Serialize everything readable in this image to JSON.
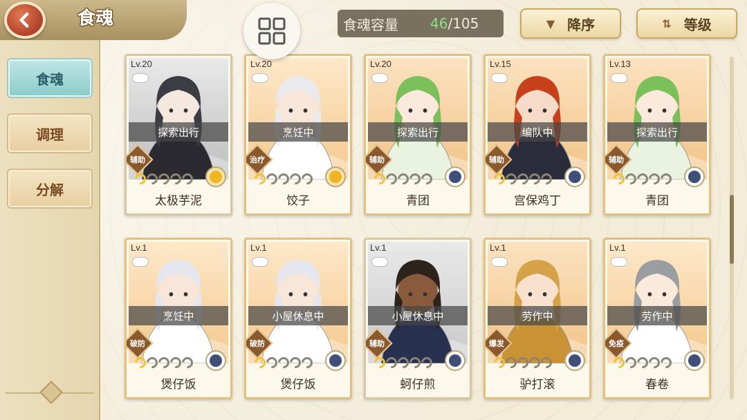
{
  "header": {
    "back_icon": "chevron-left-icon",
    "title": "食魂",
    "grid_icon": "grid-view-icon",
    "capacity_label": "食魂容量",
    "capacity_current": "46",
    "capacity_total": "/105",
    "sort_order_label": "降序",
    "sort_field_label": "等级"
  },
  "sidebar": {
    "tabs": [
      {
        "label": "食魂",
        "active": true
      },
      {
        "label": "调理",
        "active": false
      },
      {
        "label": "分解",
        "active": false
      }
    ]
  },
  "cards": [
    {
      "level": "Lv.20",
      "status": "探索出行",
      "role": "辅助",
      "stars": 1,
      "name": "太极芋泥",
      "element": "yellow",
      "palette": "mono"
    },
    {
      "level": "Lv.20",
      "status": "烹饪中",
      "role": "治疗",
      "stars": 1,
      "name": "饺子",
      "element": "yellow",
      "palette": "white"
    },
    {
      "level": "Lv.20",
      "status": "探索出行",
      "role": "辅助",
      "stars": 1,
      "name": "青团",
      "element": "blue",
      "palette": "green"
    },
    {
      "level": "Lv.15",
      "status": "编队中",
      "role": "辅助",
      "stars": 1,
      "name": "宫保鸡丁",
      "element": "blue",
      "palette": "red"
    },
    {
      "level": "Lv.13",
      "status": "探索出行",
      "role": "辅助",
      "stars": 1,
      "name": "青团",
      "element": "blue",
      "palette": "green"
    },
    {
      "level": "Lv.1",
      "status": "烹饪中",
      "role": "破防",
      "stars": 1,
      "name": "煲仔饭",
      "element": "blue",
      "palette": "teal"
    },
    {
      "level": "Lv.1",
      "status": "小屋休息中",
      "role": "破防",
      "stars": 1,
      "name": "煲仔饭",
      "element": "blue",
      "palette": "teal"
    },
    {
      "level": "Lv.1",
      "status": "小屋休息中",
      "role": "辅助",
      "stars": 1,
      "name": "蚵仔煎",
      "element": "blue",
      "palette": "dark"
    },
    {
      "level": "Lv.1",
      "status": "劳作中",
      "role": "爆发",
      "stars": 1,
      "name": "驴打滚",
      "element": "blue",
      "palette": "gold"
    },
    {
      "level": "Lv.1",
      "status": "劳作中",
      "role": "免疫",
      "stars": 1,
      "name": "春卷",
      "element": "blue",
      "palette": "pink"
    }
  ],
  "colors": {
    "accent_teal": "#8cccc9",
    "capacity_value": "#8ee08a",
    "back_button": "#b1412a"
  }
}
